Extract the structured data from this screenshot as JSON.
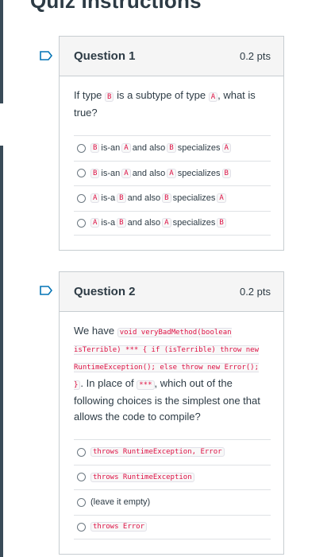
{
  "page": {
    "title": "Quiz Instructions"
  },
  "questions": [
    {
      "title": "Question 1",
      "points": "0.2 pts",
      "prompt": {
        "t1": "If type ",
        "c1": "B",
        "t2": " is a subtype of type ",
        "c2": "A",
        "t3": ", what is true?"
      },
      "answers": [
        {
          "c1": "B",
          "t1": "is-an",
          "c2": "A",
          "t2": "and also",
          "c3": "B",
          "t3": "specializes",
          "c4": "A"
        },
        {
          "c1": "B",
          "t1": "is-an",
          "c2": "A",
          "t2": "and also",
          "c3": "A",
          "t3": "specializes",
          "c4": "B"
        },
        {
          "c1": "A",
          "t1": "is-a",
          "c2": "B",
          "t2": "and also",
          "c3": "B",
          "t3": "specializes",
          "c4": "A"
        },
        {
          "c1": "A",
          "t1": "is-a",
          "c2": "B",
          "t2": "and also",
          "c3": "A",
          "t3": "specializes",
          "c4": "B"
        }
      ]
    },
    {
      "title": "Question 2",
      "points": "0.2 pts",
      "prompt": {
        "t1": "We have ",
        "code1": "void veryBadMethod(boolean isTerrible) *** { if (isTerrible) throw new RuntimeException(); else throw new Error(); }",
        "t2": ". In place of ",
        "code2": "***",
        "t3": ", which out of the following choices is the simplest one that allows the code to compile?"
      },
      "answers": [
        {
          "code": "throws RuntimeException, Error",
          "text": ""
        },
        {
          "code": "throws RuntimeException",
          "text": ""
        },
        {
          "code": "",
          "text": "(leave it empty)"
        },
        {
          "code": "throws Error",
          "text": ""
        }
      ]
    }
  ],
  "colors": {
    "accent": "#0374b5",
    "code_text": "#dd1144",
    "border": "#c7cdd1",
    "header_bg": "#f5f5f5"
  },
  "icons": {
    "flag": "flag-icon",
    "radio": "radio-icon"
  }
}
